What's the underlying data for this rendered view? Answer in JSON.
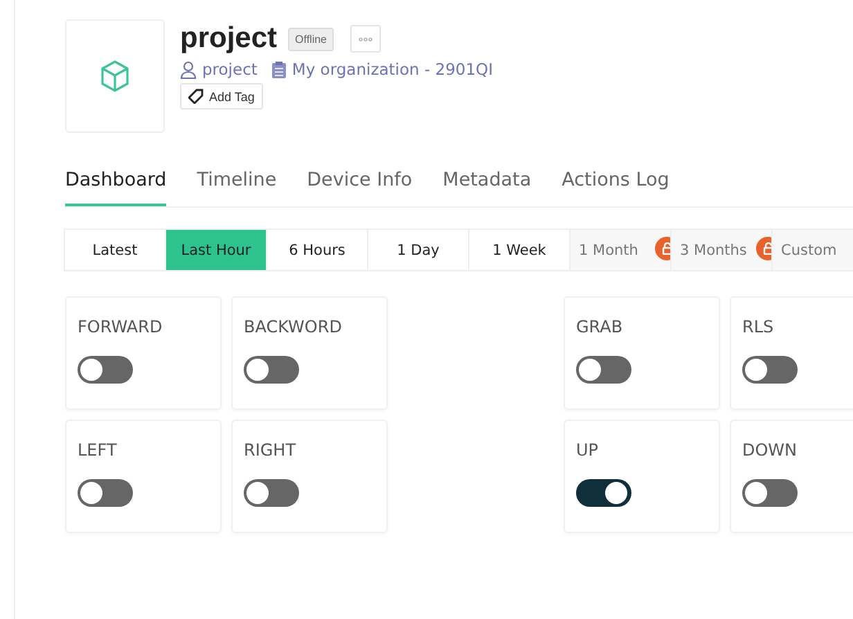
{
  "device": {
    "name": "project",
    "status": "Offline",
    "owner": "project",
    "organization": "My organization - 2901QI",
    "add_tag": "Add Tag"
  },
  "tabs": [
    {
      "label": "Dashboard",
      "selected": true
    },
    {
      "label": "Timeline",
      "selected": false
    },
    {
      "label": "Device Info",
      "selected": false
    },
    {
      "label": "Metadata",
      "selected": false
    },
    {
      "label": "Actions Log",
      "selected": false
    }
  ],
  "time_ranges": [
    {
      "label": "Latest",
      "selected": false,
      "locked": false
    },
    {
      "label": "Last Hour",
      "selected": true,
      "locked": false
    },
    {
      "label": "6 Hours",
      "selected": false,
      "locked": false
    },
    {
      "label": "1 Day",
      "selected": false,
      "locked": false
    },
    {
      "label": "1 Week",
      "selected": false,
      "locked": false
    },
    {
      "label": "1 Month",
      "selected": false,
      "locked": true
    },
    {
      "label": "3 Months",
      "selected": false,
      "locked": true
    },
    {
      "label": "Custom",
      "selected": false,
      "locked": true
    }
  ],
  "switches": [
    {
      "label": "FORWARD",
      "on": false
    },
    {
      "label": "BACKWORD",
      "on": false
    },
    {
      "label": "GRAB",
      "on": false
    },
    {
      "label": "RLS",
      "on": false
    },
    {
      "label": "LEFT",
      "on": false
    },
    {
      "label": "RIGHT",
      "on": false
    },
    {
      "label": "UP",
      "on": true
    },
    {
      "label": "DOWN",
      "on": false
    }
  ]
}
